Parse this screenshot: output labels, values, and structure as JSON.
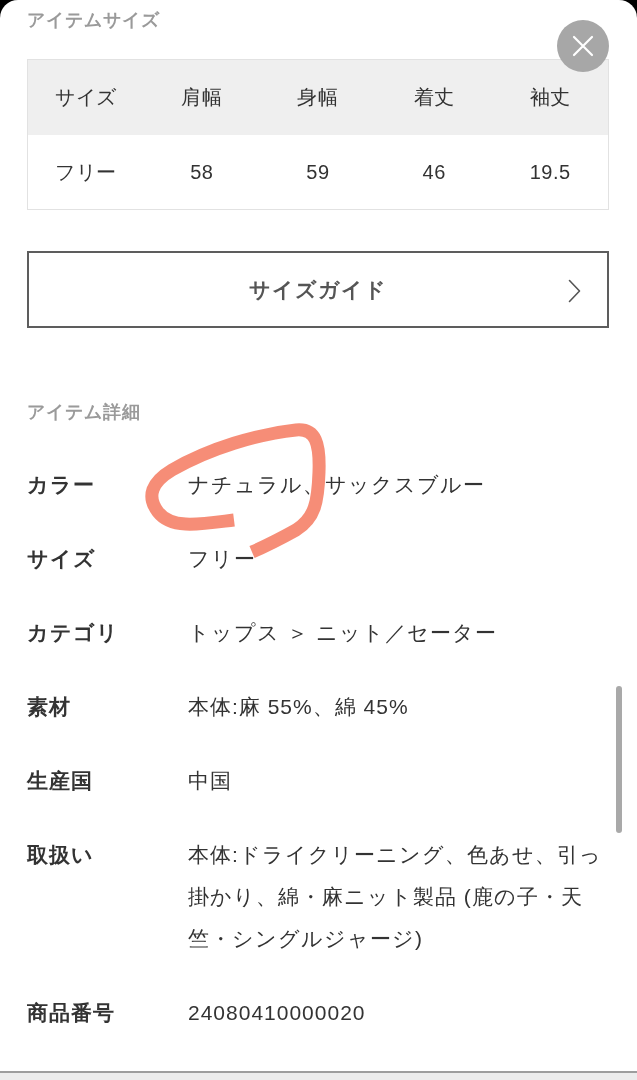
{
  "size_section": {
    "title": "アイテムサイズ",
    "table": {
      "columns": [
        "サイズ",
        "肩幅",
        "身幅",
        "着丈",
        "袖丈"
      ],
      "rows": [
        [
          "フリー",
          "58",
          "59",
          "46",
          "19.5"
        ]
      ]
    }
  },
  "size_guide_button": {
    "label": "サイズガイド"
  },
  "detail_section": {
    "title": "アイテム詳細",
    "items": [
      {
        "label": "カラー",
        "value": "ナチュラル、サックスブルー"
      },
      {
        "label": "サイズ",
        "value": "フリー"
      },
      {
        "label": "カテゴリ",
        "value": "トップス ＞ ニット／セーター"
      },
      {
        "label": "素材",
        "value": "本体:麻 55%、綿 45%"
      },
      {
        "label": "生産国",
        "value": "中国"
      },
      {
        "label": "取扱い",
        "value": "本体:ドライクリーニング、色あせ、引っ掛かり、綿・麻ニット製品 (鹿の子・天竺・シングルジャージ)"
      },
      {
        "label": "商品番号",
        "value": "24080410000020"
      }
    ]
  },
  "annotations": [
    {
      "kind": "freehand-circle"
    }
  ]
}
